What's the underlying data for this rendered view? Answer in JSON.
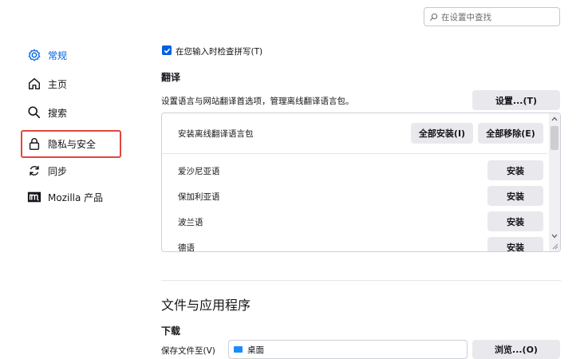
{
  "search": {
    "placeholder": "在设置中查找"
  },
  "sidebar": {
    "items": [
      {
        "label": "常规",
        "icon": "gear-icon"
      },
      {
        "label": "主页",
        "icon": "home-icon"
      },
      {
        "label": "搜索",
        "icon": "search-icon"
      },
      {
        "label": "隐私与安全",
        "icon": "lock-icon"
      },
      {
        "label": "同步",
        "icon": "sync-icon"
      },
      {
        "label": "Mozilla 产品",
        "icon": "mozilla-icon"
      }
    ]
  },
  "main": {
    "spellcheck_label": "在您输入时检查拼写(T)",
    "translation": {
      "heading": "翻译",
      "description": "设置语言与网站翻译首选项，管理离线翻译语言包。",
      "settings_button": "设置...(T)",
      "install_header": "安装离线翻译语言包",
      "install_all_button": "全部安装(I)",
      "remove_all_button": "全部移除(E)",
      "languages": [
        {
          "name": "爱沙尼亚语",
          "button": "安装"
        },
        {
          "name": "保加利亚语",
          "button": "安装"
        },
        {
          "name": "波兰语",
          "button": "安装"
        },
        {
          "name": "德语",
          "button": "安装"
        }
      ]
    },
    "files_apps": {
      "heading": "文件与应用程序",
      "downloads_heading": "下载",
      "save_to_label": "保存文件至(V)",
      "save_to_value": "桌面",
      "browse_button": "浏览...(O)"
    }
  },
  "colors": {
    "accent": "#0061e0",
    "highlight_border": "#e2463c"
  }
}
